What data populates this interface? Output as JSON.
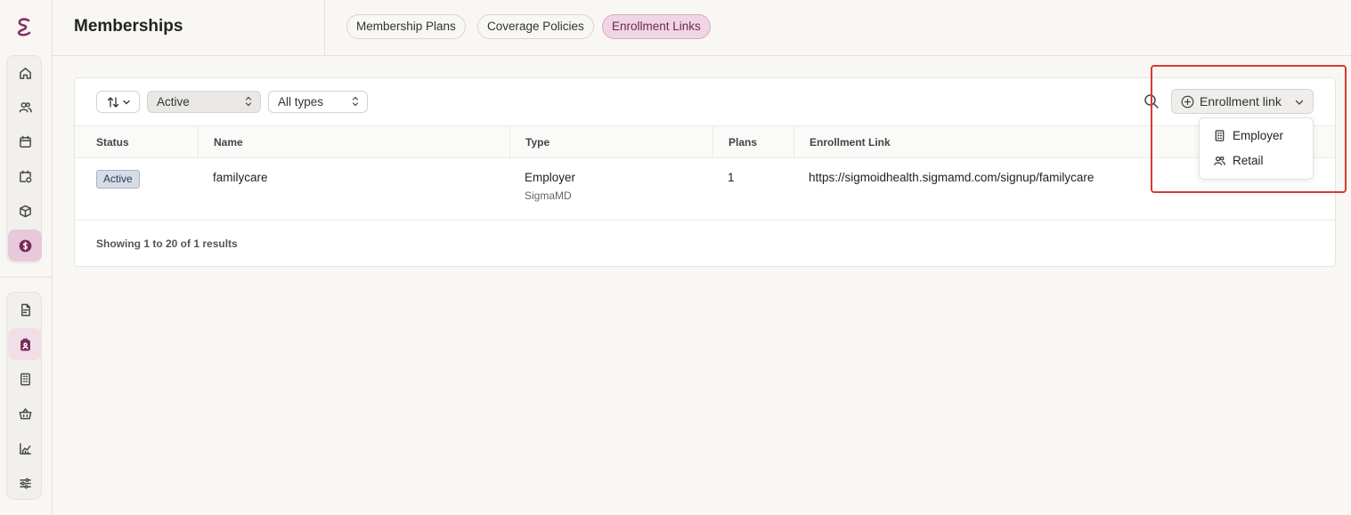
{
  "header": {
    "title": "Memberships",
    "tabs": [
      {
        "label": "Membership Plans",
        "active": false
      },
      {
        "label": "Coverage Policies",
        "active": false
      },
      {
        "label": "Enrollment Links",
        "active": true
      }
    ]
  },
  "sidebar": {
    "group1": [
      "home-icon",
      "users-icon",
      "calendar-icon",
      "calendar-check-icon",
      "box-icon",
      "dollar-icon"
    ],
    "group2": [
      "document-icon",
      "badge-icon",
      "building-icon",
      "basket-icon",
      "chart-icon",
      "sliders-icon"
    ]
  },
  "toolbar": {
    "status_filter": "Active",
    "type_filter": "All types",
    "enroll_button": "Enrollment link"
  },
  "table": {
    "columns": [
      "Status",
      "Name",
      "Type",
      "Plans",
      "Enrollment Link"
    ],
    "rows": [
      {
        "status": "Active",
        "name": "familycare",
        "type": "Employer",
        "type_sub": "SigmaMD",
        "plans": "1",
        "link": "https://sigmoidhealth.sigmamd.com/signup/familycare"
      }
    ],
    "footer": "Showing 1 to 20 of 1 results"
  },
  "menu": {
    "items": [
      {
        "label": "Employer",
        "icon": "building-icon"
      },
      {
        "label": "Retail",
        "icon": "users-icon"
      }
    ]
  },
  "colors": {
    "accent": "#7a2a5a",
    "active_tab_bg": "#f0d6e3",
    "highlight": "#d93a2f"
  }
}
